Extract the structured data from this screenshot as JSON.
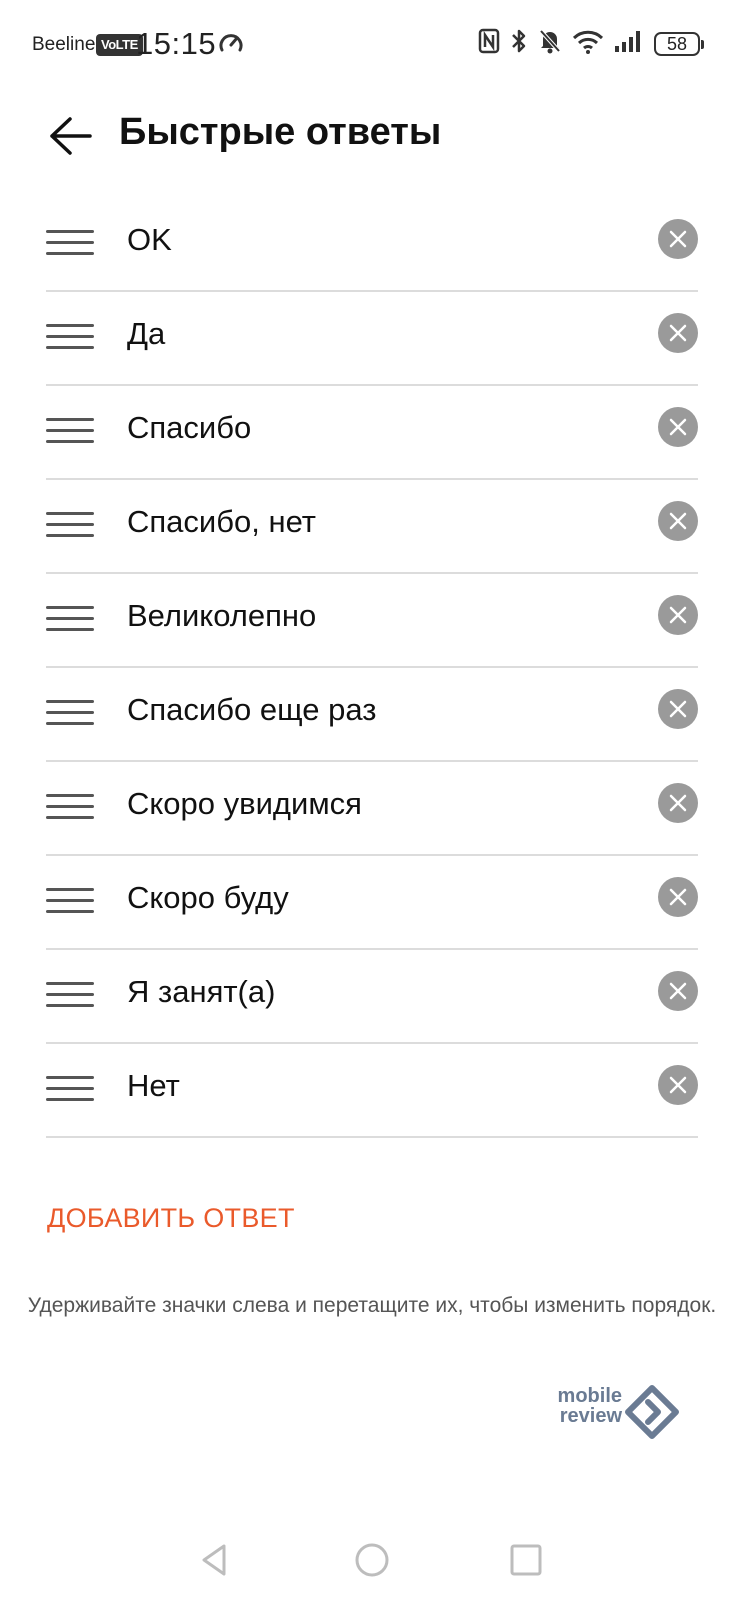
{
  "status_bar": {
    "carrier": "Beeline",
    "network_badge": "VoLTE",
    "time": "15:15",
    "battery": "58",
    "icons": [
      "speedometer-icon",
      "nfc-icon",
      "bluetooth-icon",
      "bell-muted-icon",
      "wifi-icon",
      "signal-icon",
      "battery-icon"
    ]
  },
  "header": {
    "title": "Быстрые ответы",
    "back_icon": "arrow-left-icon"
  },
  "replies": [
    {
      "text": "OK"
    },
    {
      "text": "Да"
    },
    {
      "text": "Спасибо"
    },
    {
      "text": "Спасибо, нет"
    },
    {
      "text": "Великолепно"
    },
    {
      "text": "Спасибо еще раз"
    },
    {
      "text": "Скоро увидимся"
    },
    {
      "text": "Скоро буду"
    },
    {
      "text": "Я занят(а)"
    },
    {
      "text": "Нет"
    }
  ],
  "row_icons": {
    "drag": "drag-handle-icon",
    "remove": "close-circle-icon"
  },
  "add_reply_label": "ДОБАВИТЬ ОТВЕТ",
  "hint": "Удерживайте значки слева и перетащите их, чтобы изменить порядок.",
  "watermark": {
    "line1": "mobile",
    "line2": "review"
  },
  "nav_bar": {
    "icons": [
      "back-triangle-icon",
      "home-circle-icon",
      "recents-square-icon"
    ]
  },
  "colors": {
    "accent": "#ea5a2b",
    "remove_button": "#9a9a9a",
    "divider": "#dcdcdc",
    "watermark": "#6a7b93"
  }
}
